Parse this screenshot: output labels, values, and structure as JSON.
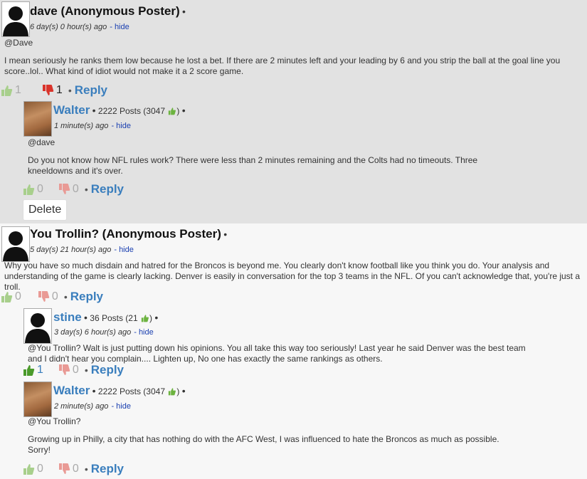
{
  "comments": [
    {
      "name": "dave (Anonymous Poster)",
      "time": "6 day(s) 0 hour(s) ago",
      "hide": "- hide",
      "mention": "@Dave",
      "text": "I mean seriously he ranks them low because he lost a bet. If there are 2 minutes left and your leading by 6 and you strip the ball at the goal line you score..lol.. What kind of idiot would not make it a 2 score game.",
      "up": "1",
      "down": "1",
      "reply": "Reply"
    },
    {
      "name": "Walter",
      "posts": "2222 Posts (3047",
      "time": "1 minute(s) ago",
      "hide": "- hide",
      "mention": "@dave",
      "text": "Do you not know how NFL rules work? There were less than 2 minutes remaining and the Colts had no timeouts. Three kneeldowns and it's over.",
      "up": "0",
      "down": "0",
      "reply": "Reply",
      "delete": "Delete"
    },
    {
      "name": "You Trollin? (Anonymous Poster)",
      "time": "5 day(s) 21 hour(s) ago",
      "hide": "- hide",
      "text": "Why you have so much disdain and hatred for the Broncos is beyond me. You clearly don't know football like you think you do. Your analysis and understanding of the game is clearly lacking. Denver is easily in conversation for the top 3 teams in the NFL. Of you can't acknowledge that, you're just a troll.",
      "up": "0",
      "down": "0",
      "reply": "Reply"
    },
    {
      "name": "stine",
      "posts": "36 Posts (21",
      "time": "3 day(s) 6 hour(s) ago",
      "hide": "- hide",
      "text": "@You Trollin?  Walt is just putting down his opinions. You all take this way too seriously! Last year he said Denver was the best team and I didn't hear you complain.... Lighten up, No one has exactly the same rankings as others.",
      "up": "1",
      "down": "0",
      "reply": "Reply"
    },
    {
      "name": "Walter",
      "posts": "2222 Posts (3047",
      "time": "2 minute(s) ago",
      "hide": "- hide",
      "mention": "@You Trollin?",
      "text": "Growing up in Philly, a city that has nothing do with the AFC West, I was influenced to hate the Broncos as much as possible.",
      "text2": "Sorry!",
      "up": "0",
      "down": "0",
      "reply": "Reply"
    }
  ],
  "icons": {
    "up": "thumbs-up-icon",
    "down": "thumbs-down-icon",
    "avatar": "user-silhouette-icon"
  },
  "colors": {
    "link": "#3a7ebd",
    "thumbUp": "#6cb33f",
    "thumbDown": "#d9342b"
  }
}
